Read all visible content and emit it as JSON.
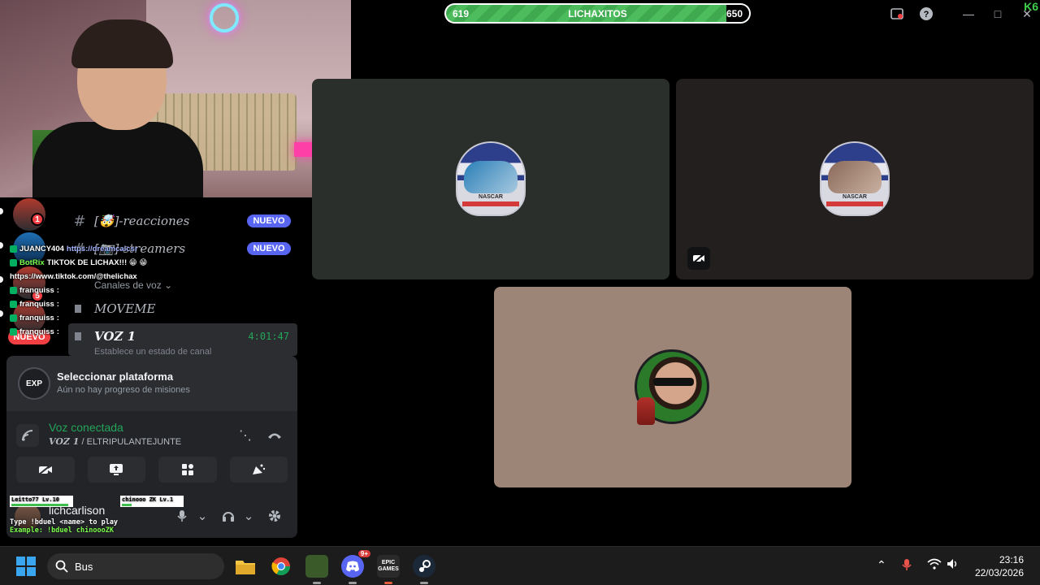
{
  "stats_bar": {
    "left_value": "619",
    "center_label": "LICHAXITOS",
    "right_value": "650"
  },
  "corner_badge": "K6",
  "channels": {
    "items": [
      {
        "prefix": "#",
        "name": "[🤯]-reacciones",
        "badge": "NUEVO"
      },
      {
        "prefix": "#",
        "name": "[📷]-streamers",
        "badge": "NUEVO"
      }
    ],
    "voice_header": "Canales de voz",
    "voice_channels": [
      {
        "name": "MOVEME"
      },
      {
        "name": "VOZ 1",
        "timer": "4:01:47",
        "status": "Establece un estado de canal"
      }
    ]
  },
  "guilds": {
    "first_count": "1",
    "second_count": "5",
    "new_badge": "NUEVO"
  },
  "chat": [
    {
      "user": "JUANCY404",
      "message": "https://dreamcalcsr",
      "type": "link"
    },
    {
      "user": "BotRix",
      "message": "TIKTOK DE LICHAX!!! 😁 😁",
      "type": "bot"
    },
    {
      "user": "",
      "message": "https://www.tiktok.com/@thelichax",
      "type": "plain"
    },
    {
      "user": "franquiss",
      "message": ":",
      "type": "user"
    },
    {
      "user": "franquiss",
      "message": ":",
      "type": "user"
    },
    {
      "user": "franquiss",
      "message": ":",
      "type": "user"
    },
    {
      "user": "franquiss",
      "message": ":",
      "type": "user"
    }
  ],
  "platform_card": {
    "logo_text": "EXP",
    "title": "Seleccionar plataforma",
    "subtitle": "Aún no hay progreso de misiones"
  },
  "voice_panel": {
    "state": "Voz conectada",
    "channel": "VOZ 1",
    "server": "ELTRIPULANTEJUNTE"
  },
  "user_panel": {
    "username": "lichcarlison"
  },
  "duel_overlay": {
    "player1": "Leitto77",
    "player1_level": "Lv.10",
    "player2": "chinooo ZK",
    "player2_level": "Lv.1",
    "line1": "Type !bduel <name> to play",
    "line2": "Example: !bduel chinoooZK"
  },
  "tiles": {
    "helmet_brand": "NASCAR"
  },
  "taskbar": {
    "search_text": "Bus",
    "discord_badge": "9+",
    "epic_label": "EPIC GAMES",
    "time": "23:16",
    "date": "22/03/2026"
  },
  "colors": {
    "accent_green": "#23a55a",
    "badge_blue": "#5865f2",
    "badge_red": "#f23f43",
    "stat_green": "#3ea94e"
  },
  "icons": [
    "search-icon",
    "question-icon",
    "minimize-icon",
    "maximize-icon",
    "close-icon",
    "camera-off-icon",
    "mic-icon",
    "headphones-icon",
    "gear-icon",
    "hangup-icon"
  ]
}
